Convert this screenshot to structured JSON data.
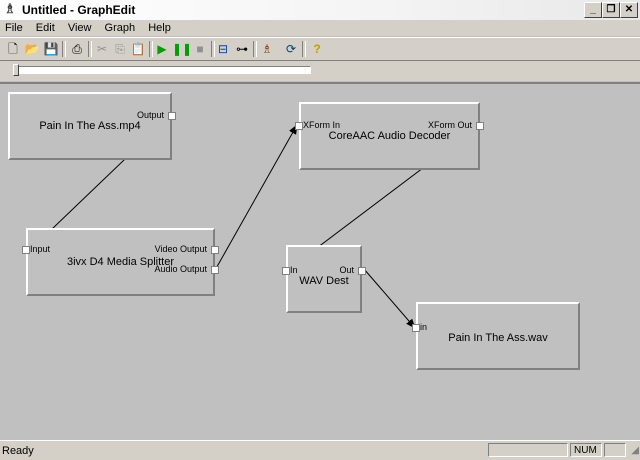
{
  "window": {
    "title": "Untitled - GraphEdit",
    "app_icon": "graphedit-logo-icon"
  },
  "menu": [
    "File",
    "Edit",
    "View",
    "Graph",
    "Help"
  ],
  "toolbar": {
    "icons": [
      "new-icon",
      "open-icon",
      "save-icon",
      "print-icon",
      "cut-icon",
      "copy-icon",
      "paste-icon",
      "play-icon",
      "pause-icon",
      "stop-icon",
      "connect-icon",
      "disconnect-icon",
      "graph-icon",
      "refresh-icon",
      "help-icon"
    ],
    "play_color": "#00a000"
  },
  "seek": {
    "position": 0
  },
  "graph": {
    "filters": [
      {
        "name": "Pain In The Ass.mp4",
        "pins_out": [
          "Output"
        ],
        "pins_in": []
      },
      {
        "name": "3ivx D4 Media Splitter",
        "pins_in": [
          "Input"
        ],
        "pins_out": [
          "Video Output",
          "Audio Output"
        ]
      },
      {
        "name": "CoreAAC Audio Decoder",
        "pins_in": [
          "XForm In"
        ],
        "pins_out": [
          "XForm Out"
        ]
      },
      {
        "name": "WAV Dest",
        "pins_in": [
          "In"
        ],
        "pins_out": [
          "Out"
        ]
      },
      {
        "name": "Pain In The Ass.wav",
        "pins_in": [
          "in"
        ],
        "pins_out": []
      }
    ]
  },
  "status": {
    "text": "Ready",
    "num": "NUM"
  }
}
